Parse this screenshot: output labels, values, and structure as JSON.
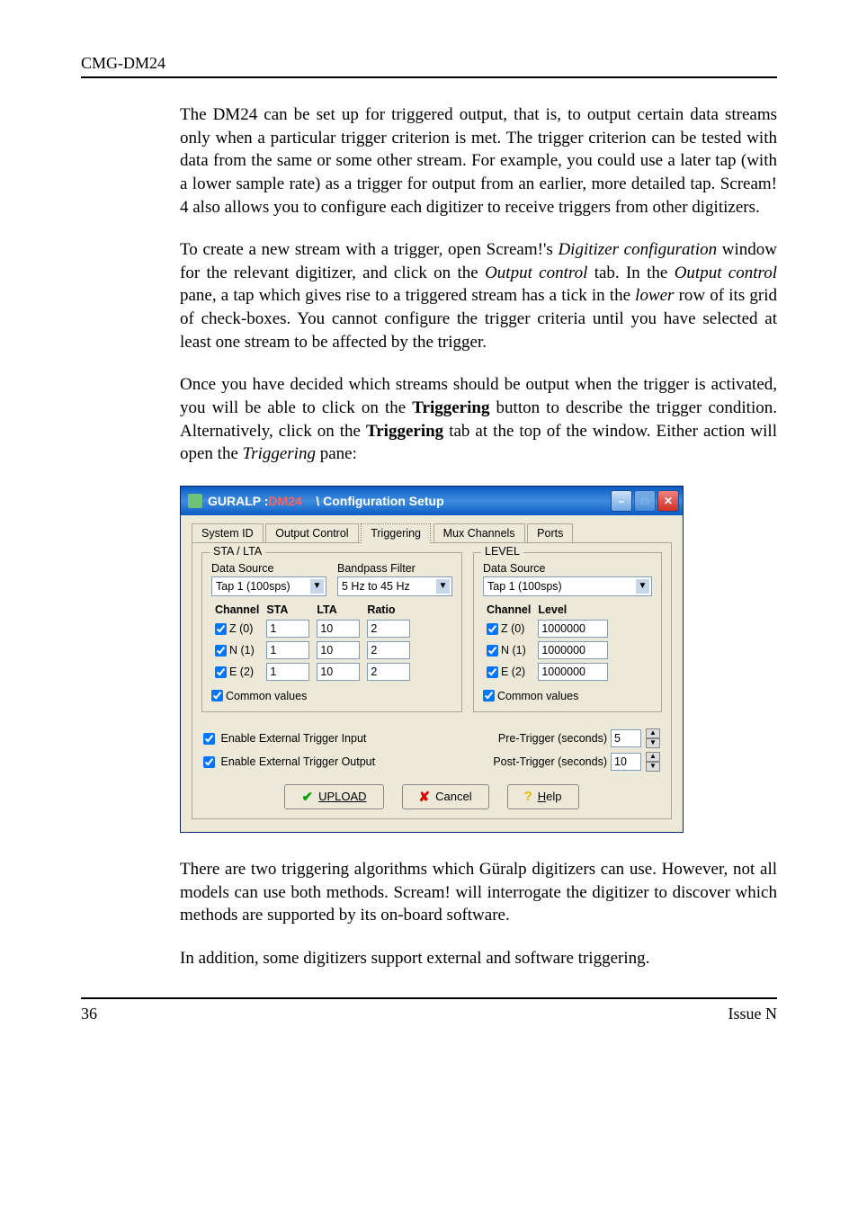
{
  "header": "CMG-DM24",
  "p1": "The DM24 can be set up for triggered output, that is, to output certain data streams only when a particular trigger criterion is met. The trigger criterion can be tested with data from the same or some other stream. For example, you could use a later tap (with a lower sample rate) as a trigger for output from an earlier, more detailed tap. Scream! 4 also allows you to configure each digitizer to receive triggers from other digitizers.",
  "p2a": "To create a new stream with a trigger, open Scream!'s ",
  "p2b": "Digitizer configuration",
  "p2c": " window for the relevant digitizer, and click on the ",
  "p2d": "Output control",
  "p2e": " tab. In the ",
  "p2f": "Output control",
  "p2g": " pane, a tap which gives rise to a triggered stream has a tick in the ",
  "p2h": "lower",
  "p2i": " row of its grid of check-boxes. You cannot configure the trigger criteria until you have selected at least one stream to be affected by the trigger.",
  "p3a": "Once you have decided which streams should be output when the trigger is activated, you will be able to click on the ",
  "p3b": "Triggering",
  "p3c": " button to describe the trigger condition. Alternatively, click on the ",
  "p3d": "Triggering",
  "p3e": " tab at the top of the window. Either action will open the ",
  "p3f": "Triggering",
  "p3g": " pane:",
  "p4": "There are two triggering algorithms which Güralp digitizers can use. However, not all models can use both methods. Scream! will interrogate the digitizer to discover which methods are supported by its on-board software.",
  "p5": "In addition, some digitizers support external and software triggering.",
  "footer_left": "36",
  "footer_right": "Issue N",
  "dialog": {
    "title_a": "GURALP : ",
    "title_b": "DM24",
    "title_c": "    \\ Configuration Setup",
    "tabs": [
      "System ID",
      "Output Control",
      "Triggering",
      "Mux Channels",
      "Ports"
    ],
    "activeTab": 2,
    "sta": {
      "groupTitle": "STA / LTA",
      "dsLabel": "Data Source",
      "ds": "Tap 1 (100sps)",
      "bpLabel": "Bandpass Filter",
      "bp": "5 Hz to 45 Hz",
      "cols": [
        "Channel",
        "STA",
        "LTA",
        "Ratio"
      ],
      "rows": [
        {
          "ch": "Z (0)",
          "chk": true,
          "sta": "1",
          "lta": "10",
          "ratio": "2"
        },
        {
          "ch": "N (1)",
          "chk": true,
          "sta": "1",
          "lta": "10",
          "ratio": "2"
        },
        {
          "ch": "E (2)",
          "chk": true,
          "sta": "1",
          "lta": "10",
          "ratio": "2"
        }
      ],
      "common": "Common values",
      "commonChk": true
    },
    "level": {
      "groupTitle": "LEVEL",
      "dsLabel": "Data Source",
      "ds": "Tap 1 (100sps)",
      "cols": [
        "Channel",
        "Level"
      ],
      "rows": [
        {
          "ch": "Z (0)",
          "chk": true,
          "level": "1000000"
        },
        {
          "ch": "N (1)",
          "chk": true,
          "level": "1000000"
        },
        {
          "ch": "E (2)",
          "chk": true,
          "level": "1000000"
        }
      ],
      "common": "Common values",
      "commonChk": true
    },
    "extIn": {
      "label": "Enable External Trigger Input",
      "chk": true
    },
    "extOut": {
      "label": "Enable External Trigger Output",
      "chk": true
    },
    "pre": {
      "label": "Pre-Trigger (seconds)",
      "val": "5"
    },
    "post": {
      "label": "Post-Trigger (seconds)",
      "val": "10"
    },
    "buttons": {
      "upload": "UPLOAD",
      "cancel": "Cancel",
      "help": "Help"
    }
  }
}
